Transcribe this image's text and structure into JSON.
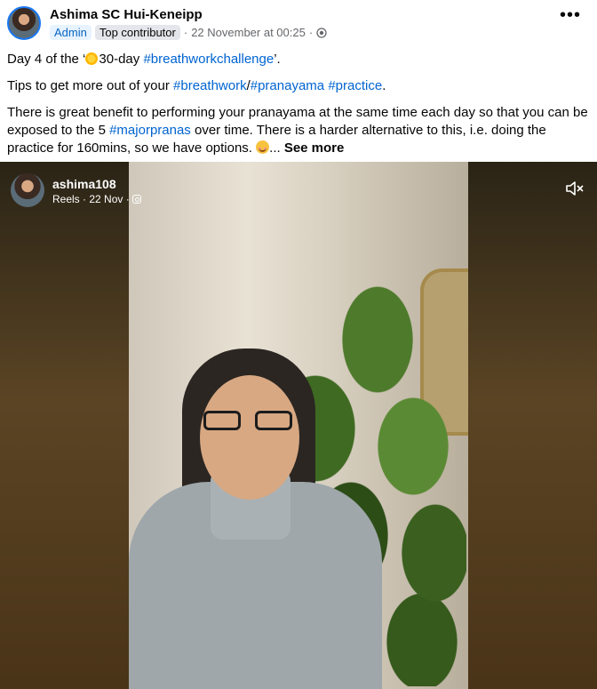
{
  "post": {
    "author": "Ashima SC Hui-Keneipp",
    "badge_admin": "Admin",
    "badge_top": "Top contributor",
    "separator1": "·",
    "timestamp": "22 November at 00:25",
    "separator2": "·",
    "more_label": "•••",
    "line1_pre": "Day 4 of the ‘",
    "line1_mid": "30-day ",
    "line1_tag": "#breathworkchallenge",
    "line1_post": "’.",
    "line2_pre": "Tips to get more out of your ",
    "line2_tag1": "#breathwork",
    "line2_slash": "/",
    "line2_tag2": "#pranayama",
    "line2_space": " ",
    "line2_tag3": "#practice",
    "line2_post": ".",
    "line3_pre": "There is great benefit to performing your pranayama at the same time each day so that you can be exposed to the 5 ",
    "line3_tag": "#majorpranas",
    "line3_post": " over time. There is a harder alternative to this, i.e. doing the practice for 160mins, so we have options. ",
    "ellipsis": "... ",
    "see_more": "See more"
  },
  "reel": {
    "username": "ashima108",
    "subtitle": "Reels · 22 Nov ·"
  },
  "icons": {
    "globe": "globe-icon",
    "mute": "speaker-muted-icon",
    "instagram": "instagram-icon"
  },
  "colors": {
    "hashtag": "#0064d1",
    "admin_badge": "#0a66c2"
  }
}
